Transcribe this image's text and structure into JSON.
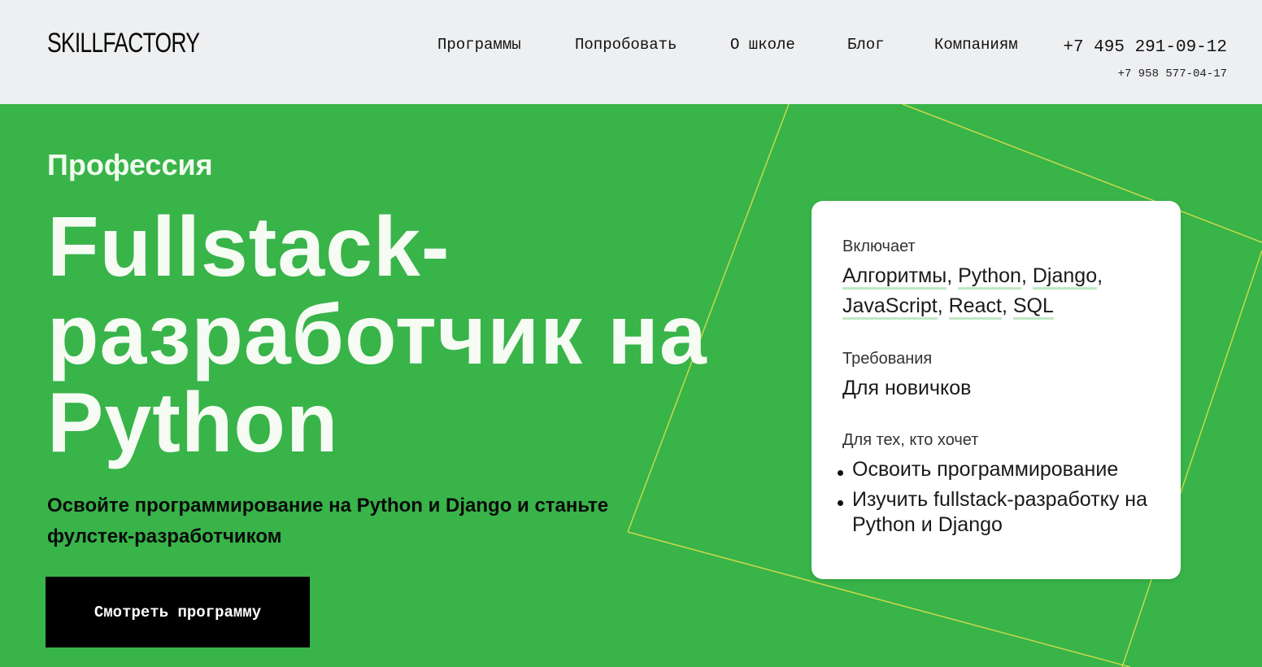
{
  "header": {
    "logo": "SkillFactory",
    "nav": [
      {
        "label": "Программы"
      },
      {
        "label": "Попробовать"
      },
      {
        "label": "О школе"
      },
      {
        "label": "Блог"
      },
      {
        "label": "Компаниям"
      }
    ],
    "phone_main": "+7 495 291-09-12",
    "phone_secondary": "+7 958 577-04-17"
  },
  "hero": {
    "kicker": "Профессия",
    "title_line1": "Fullstack-",
    "title_line2": "разработчик на",
    "title_line3": "Python",
    "subtitle": "Освойте программирование на Python и Django и станьте фулстек-разработчиком",
    "cta_label": "Смотреть программу"
  },
  "card": {
    "includes_label": "Включает",
    "includes": [
      "Алгоритмы",
      "Python",
      "Django",
      "JavaScript",
      "React",
      "SQL"
    ],
    "requirements_label": "Требования",
    "requirements_value": "Для новичков",
    "audience_label": "Для тех, кто хочет",
    "audience": [
      "Освоить программирование",
      "Изучить fullstack-разработку на Python и Django"
    ]
  },
  "colors": {
    "hero_bg": "#38b449",
    "header_bg": "#eeeff1",
    "line_accent": "#c8d94a"
  }
}
